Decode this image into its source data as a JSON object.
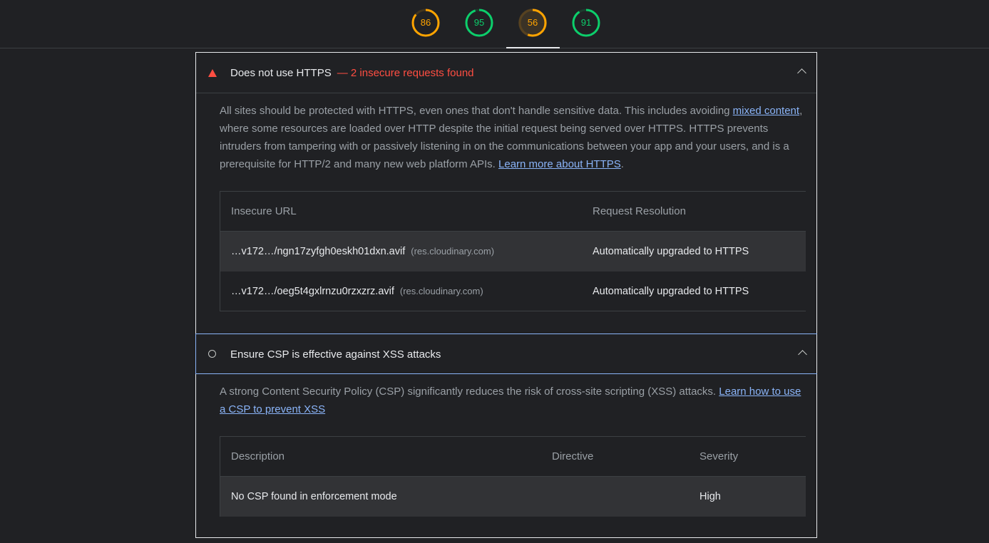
{
  "gauges": [
    {
      "score": "86",
      "fraction": 0.86,
      "color": "#ffa400"
    },
    {
      "score": "95",
      "fraction": 0.95,
      "color": "#0cce6b"
    },
    {
      "score": "56",
      "fraction": 0.56,
      "color": "#ffa400"
    },
    {
      "score": "91",
      "fraction": 0.91,
      "color": "#0cce6b"
    }
  ],
  "https_audit": {
    "title": "Does not use HTTPS",
    "display_value": "— 2 insecure requests found",
    "description_parts": {
      "p1": "All sites should be protected with HTTPS, even ones that don't handle sensitive data. This includes avoiding ",
      "link1": "mixed content",
      "p2": ", where some resources are loaded over HTTP despite the initial request being served over HTTPS. HTTPS prevents intruders from tampering with or passively listening in on the communications between your app and your users, and is a prerequisite for HTTP/2 and many new web platform APIs. ",
      "link2": "Learn more about HTTPS",
      "p3": "."
    },
    "table": {
      "headers": [
        "Insecure URL",
        "Request Resolution"
      ],
      "rows": [
        {
          "url": "…v172…/ngn17zyfgh0eskh01dxn.avif",
          "host": "(res.cloudinary.com)",
          "resolution": "Automatically upgraded to HTTPS"
        },
        {
          "url": "…v172…/oeg5t4gxlrnzu0rzxzrz.avif",
          "host": "(res.cloudinary.com)",
          "resolution": "Automatically upgraded to HTTPS"
        }
      ]
    }
  },
  "csp_audit": {
    "title": "Ensure CSP is effective against XSS attacks",
    "description_parts": {
      "p1": "A strong Content Security Policy (CSP) significantly reduces the risk of cross-site scripting (XSS) attacks. ",
      "link1": "Learn how to use a CSP to prevent XSS"
    },
    "table": {
      "headers": [
        "Description",
        "Directive",
        "Severity"
      ],
      "rows": [
        {
          "description": "No CSP found in enforcement mode",
          "directive": "",
          "severity": "High"
        }
      ]
    }
  },
  "colors": {
    "fail": "#ff4e42",
    "link": "#8ab4f8",
    "average": "#ffa400",
    "pass": "#0cce6b"
  }
}
